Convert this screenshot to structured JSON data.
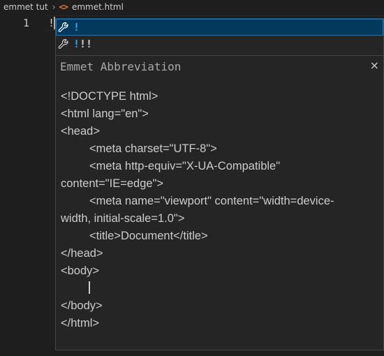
{
  "breadcrumb": {
    "folder": "emmet tut",
    "separator": "›",
    "file_icon": "<>",
    "file": "emmet.html"
  },
  "editor": {
    "line_number": "1",
    "line_text": "!"
  },
  "suggestions": [
    {
      "icon": "wrench-icon",
      "match": "!",
      "rest": "",
      "selected": true
    },
    {
      "icon": "wrench-icon",
      "match": "!",
      "rest": "!!",
      "selected": false
    }
  ],
  "details": {
    "title": "Emmet Abbreviation",
    "close": "×",
    "lines": [
      "<!DOCTYPE html>",
      "<html lang=\"en\">",
      "<head>",
      "<meta charset=\"UTF-8\">",
      "<meta http-equiv=\"X-UA-Compatible\"",
      "content=\"IE=edge\">",
      "<meta name=\"viewport\" content=\"width=device-",
      "width, initial-scale=1.0\">",
      "<title>Document</title>",
      "</head>",
      "<body>",
      "</body>",
      "</html>"
    ]
  },
  "colors": {
    "background": "#1e1e1e",
    "widget": "#252526",
    "selected": "#04395e",
    "match": "#2aaaff",
    "file_icon": "#e37933"
  }
}
